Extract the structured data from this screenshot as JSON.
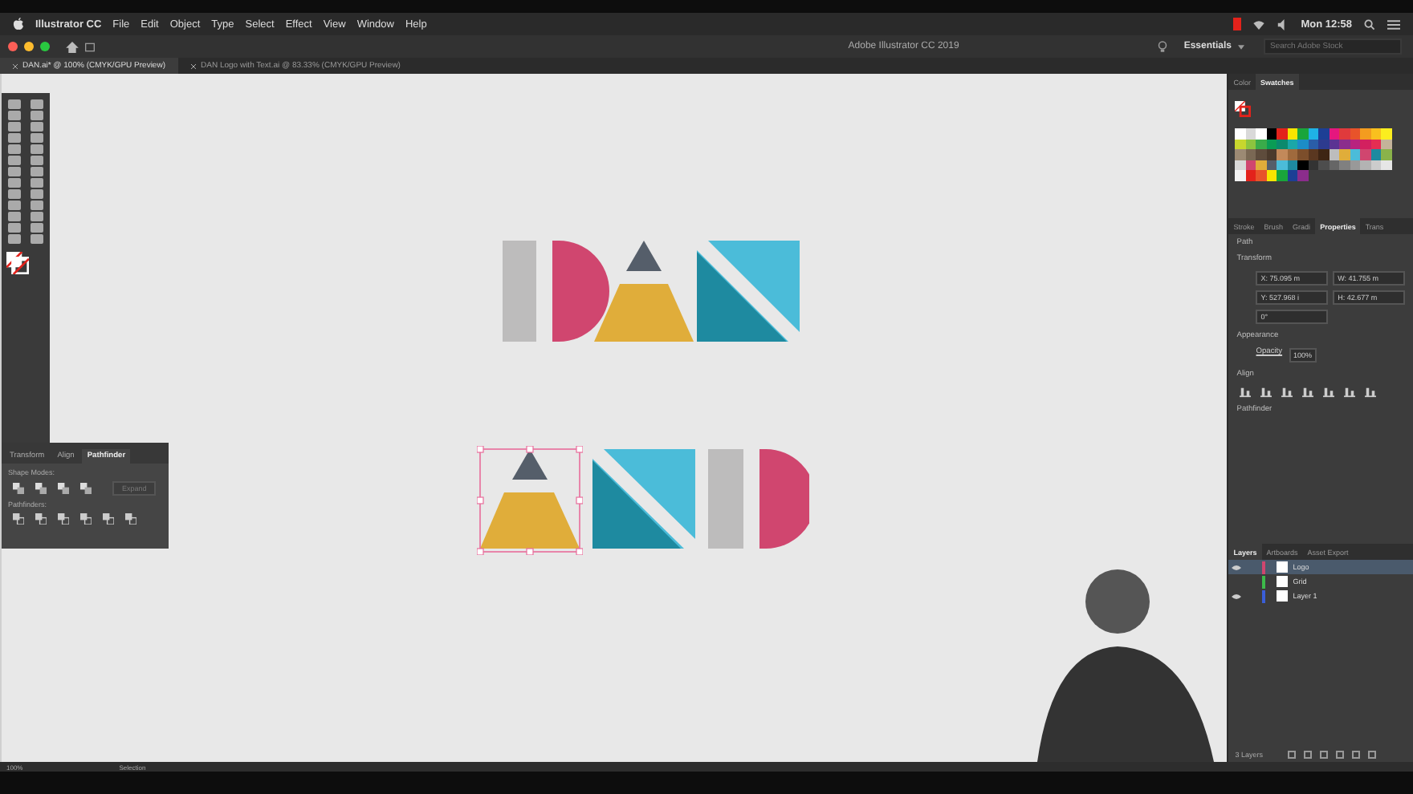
{
  "menu_bar": {
    "app": "Illustrator CC",
    "items": [
      "File",
      "Edit",
      "Object",
      "Type",
      "Select",
      "Effect",
      "View",
      "Window",
      "Help"
    ],
    "clock": "Mon 12:58"
  },
  "app_bar": {
    "title": "Adobe Illustrator CC 2019",
    "workspace": "Essentials",
    "search": {
      "placeholder": "Search Adobe Stock"
    }
  },
  "document_tabs": [
    {
      "label": "DAN.ai* @ 100% (CMYK/GPU Preview)",
      "selected": true
    },
    {
      "label": "DAN Logo with Text.ai @ 83.33% (CMYK/GPU Preview)",
      "selected": false
    }
  ],
  "pathfinder_panel": {
    "tabs": [
      {
        "label": "Transform",
        "selected": false
      },
      {
        "label": "Align",
        "selected": false
      },
      {
        "label": "Pathfinder",
        "selected": true
      }
    ],
    "shape_modes_label": "Shape Modes:",
    "expand_button": "Expand",
    "pathfinders_label": "Pathfinders:"
  },
  "swatches_panel": {
    "tabs": [
      {
        "label": "Color",
        "selected": false
      },
      {
        "label": "Swatches",
        "selected": true
      }
    ],
    "swatches": [
      {
        "color": "#ffffff"
      },
      {
        "color": "#d9d9d9"
      },
      {
        "color": "#ffffff"
      },
      {
        "color": "#000000"
      },
      {
        "color": "#e3221b"
      },
      {
        "color": "#f6e500"
      },
      {
        "color": "#19a53b"
      },
      {
        "color": "#1fb2e6"
      },
      {
        "color": "#1d3f95"
      },
      {
        "color": "#e5177e"
      },
      {
        "color": "#e03a3c"
      },
      {
        "color": "#e8532a"
      },
      {
        "color": "#f39c1f"
      },
      {
        "color": "#f9c01e"
      },
      {
        "color": "#fbee1f"
      },
      {
        "color": "#c7d62e"
      },
      {
        "color": "#8cc43f"
      },
      {
        "color": "#3aab4a"
      },
      {
        "color": "#0a9c55"
      },
      {
        "color": "#0b8a6d"
      },
      {
        "color": "#1ba7a8"
      },
      {
        "color": "#1c8dc7"
      },
      {
        "color": "#2a5da8"
      },
      {
        "color": "#2d3b8f"
      },
      {
        "color": "#5b3393"
      },
      {
        "color": "#8b2d8c"
      },
      {
        "color": "#b8237f"
      },
      {
        "color": "#d3205f"
      },
      {
        "color": "#e52d52"
      },
      {
        "color": "#c4b49a"
      },
      {
        "color": "#9c8a74"
      },
      {
        "color": "#7a6854"
      },
      {
        "color": "#5e4c3c"
      },
      {
        "color": "#4b3a2c"
      },
      {
        "color": "#c2895a"
      },
      {
        "color": "#9f6a3d"
      },
      {
        "color": "#7c4e2b"
      },
      {
        "color": "#5a3720"
      },
      {
        "color": "#3e2514"
      },
      {
        "color": "#bdbdbd"
      },
      {
        "color": "#e0ad3a"
      },
      {
        "color": "#4bbcd9"
      },
      {
        "color": "#d0466f"
      },
      {
        "color": "#1e8aa0"
      },
      {
        "color": "#8ab34a"
      },
      {
        "color": "#d9d9d9"
      },
      {
        "color": "#d0466f"
      },
      {
        "color": "#e0ad3a"
      },
      {
        "color": "#555e6a"
      },
      {
        "color": "#4bbcd9"
      },
      {
        "color": "#1e8aa0"
      },
      {
        "color": "#000000"
      },
      {
        "color": "#333333"
      },
      {
        "color": "#4d4d4d"
      },
      {
        "color": "#666666"
      },
      {
        "color": "#808080"
      },
      {
        "color": "#999999"
      },
      {
        "color": "#b3b3b3"
      },
      {
        "color": "#cccccc"
      },
      {
        "color": "#e6e6e6"
      },
      {
        "color": "#f2f2f2"
      },
      {
        "color": "#e3221b"
      },
      {
        "color": "#e8532a"
      },
      {
        "color": "#f6e500"
      },
      {
        "color": "#19a53b"
      },
      {
        "color": "#1d3f95"
      },
      {
        "color": "#8b2d8c"
      }
    ]
  },
  "properties_panel": {
    "tabs": [
      {
        "label": "Stroke",
        "selected": false
      },
      {
        "label": "Brush",
        "selected": false
      },
      {
        "label": "Gradi",
        "selected": false
      },
      {
        "label": "Properties",
        "selected": true
      },
      {
        "label": "Trans",
        "selected": false
      }
    ],
    "selection_type": "Path",
    "transform_title": "Transform",
    "fields": [
      {
        "label": "X:",
        "value": "75.095 m"
      },
      {
        "label": "W:",
        "value": "41.755 m"
      },
      {
        "label": "Y:",
        "value": "527.968 i"
      },
      {
        "label": "H:",
        "value": "42.677 m"
      }
    ],
    "angle": "0°",
    "appearance_title": "Appearance",
    "opacity_label": "Opacity",
    "opacity_value": "100%",
    "align_title": "Align",
    "pathfinder_title": "Pathfinder"
  },
  "layers_panel": {
    "tabs": [
      {
        "label": "Layers",
        "selected": true
      },
      {
        "label": "Artboards",
        "selected": false
      },
      {
        "label": "Asset Export",
        "selected": false
      }
    ],
    "layers": [
      {
        "name": "Logo",
        "color": "#d0466f",
        "selected": true,
        "visible": true
      },
      {
        "name": "Grid",
        "color": "#3dbb4a",
        "selected": false,
        "visible": false
      },
      {
        "name": "Layer 1",
        "color": "#3a5ed8",
        "selected": false,
        "visible": true
      }
    ],
    "count": "3 Layers"
  },
  "status_bar": {
    "zoom": "100%",
    "tool": "Selection"
  }
}
